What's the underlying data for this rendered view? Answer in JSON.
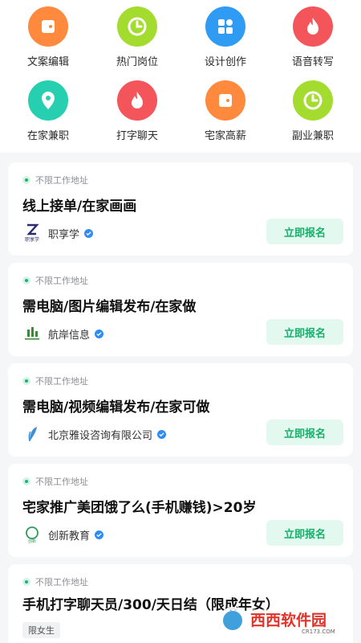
{
  "categories": [
    {
      "label": "文案编辑",
      "icon": "wallet-icon",
      "color": "#ff8a3d"
    },
    {
      "label": "热门岗位",
      "icon": "clock-icon",
      "color": "#a3dc2f"
    },
    {
      "label": "设计创作",
      "icon": "grid-icon",
      "color": "#2f9bf3"
    },
    {
      "label": "语音转写",
      "icon": "flame-icon",
      "color": "#f4555a"
    },
    {
      "label": "在家兼职",
      "icon": "location-pin-icon",
      "color": "#25cfb0"
    },
    {
      "label": "打字聊天",
      "icon": "flame-icon",
      "color": "#f4555a"
    },
    {
      "label": "宅家高薪",
      "icon": "wallet-icon",
      "color": "#ff8a3d"
    },
    {
      "label": "副业兼职",
      "icon": "clock-icon",
      "color": "#a3dc2f"
    }
  ],
  "jobs": [
    {
      "location": "不限工作地址",
      "title": "线上接单/在家画画",
      "company": "职享学",
      "logo_text": "职享学",
      "apply": "立即报名"
    },
    {
      "location": "不限工作地址",
      "title": "需电脑/图片编辑发布/在家做",
      "company": "航岸信息",
      "apply": "立即报名"
    },
    {
      "location": "不限工作地址",
      "title": "需电脑/视频编辑发布/在家可做",
      "company": "北京雅设咨询有限公司",
      "apply": "立即报名"
    },
    {
      "location": "不限工作地址",
      "title": "宅家推广美团饿了么(手机赚钱)>20岁",
      "company": "创新教育",
      "logo_text": "创新",
      "apply": "立即报名"
    },
    {
      "location": "不限工作地址",
      "title": "手机打字聊天员/300/天日结（限成年女）",
      "tag": "限女生"
    }
  ],
  "watermark": {
    "text": "西西软件园",
    "sub": "CR173.COM"
  },
  "colors": {
    "accent": "#17b06a",
    "apply_bg": "#e3f8ef",
    "verified": "#2f8cf5"
  }
}
